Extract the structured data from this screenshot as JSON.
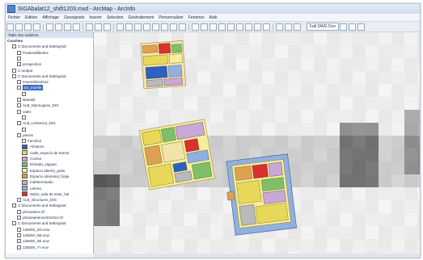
{
  "window": {
    "title": "SIGAbalat12_shift1203.mxd - ArcMap - ArcInfo"
  },
  "menu": [
    "Fichier",
    "Edition",
    "Affichage",
    "Geosignets",
    "Inserer",
    "Selection",
    "Geotraitement",
    "Personnaliser",
    "Fenetres",
    "Aide"
  ],
  "toolbar": {
    "combo_label": "Fall DWG Dov"
  },
  "toc": {
    "title": "Table des matières",
    "rows": [
      {
        "text": "Couches",
        "indent": 0,
        "bold": true
      },
      {
        "text": "C:\\Documents and Settings\\al",
        "indent": 1
      },
      {
        "text": "Postes/affaches",
        "indent": 2
      },
      {
        "text": "",
        "indent": 2
      },
      {
        "text": "prospection",
        "indent": 2
      },
      {
        "text": "C:\\output",
        "indent": 1
      },
      {
        "text": "C:\\Documents and Settings\\al",
        "indent": 1
      },
      {
        "text": "ensembles2012",
        "indent": 2
      },
      {
        "text": "Dx_moelle",
        "indent": 2,
        "selected": true
      },
      {
        "text": "",
        "indent": 3
      },
      {
        "text": "lasmaib",
        "indent": 2
      },
      {
        "text": "ALB_MursLignes_DIG",
        "indent": 2
      },
      {
        "text": "vales",
        "indent": 2
      },
      {
        "text": "",
        "indent": 3
      },
      {
        "text": "ALB_Limites12_DIG",
        "indent": 2
      },
      {
        "text": "",
        "indent": 3
      },
      {
        "text": "pieces",
        "indent": 2
      },
      {
        "text": "Function",
        "indent": 3
      },
      {
        "text": "Almacen",
        "indent": 3,
        "swatch": "#2f5fbf"
      },
      {
        "text": "Calle_espacio de transit",
        "indent": 3,
        "swatch": "#e8d85a"
      },
      {
        "text": "Cocina",
        "indent": 3,
        "swatch": "#c9a7d6"
      },
      {
        "text": "Entrada_zaguan",
        "indent": 3,
        "swatch": "#7fbf6a"
      },
      {
        "text": "Espacio abierto_patio",
        "indent": 3,
        "swatch": "#f6ee9a"
      },
      {
        "text": "Espacio artesanal_forge",
        "indent": 3,
        "swatch": "#e0a050"
      },
      {
        "text": "Indeterminado",
        "indent": 3,
        "swatch": "#b9b9b9"
      },
      {
        "text": "Letrina",
        "indent": 3,
        "swatch": "#8fb0e0"
      },
      {
        "text": "Salon_sala de estar_hal",
        "indent": 3,
        "swatch": "#d93030"
      },
      {
        "text": "ALB_Structures_DIG",
        "indent": 2
      },
      {
        "text": "C:\\Documents and Settings\\al",
        "indent": 1
      },
      {
        "text": "photo5lnec.tif",
        "indent": 2
      },
      {
        "text": "photoaerienne2010rec.tif",
        "indent": 2
      },
      {
        "text": "C:\\Documents and Settings\\al",
        "indent": 1
      },
      {
        "text": "125000_SO.ecw",
        "indent": 2
      },
      {
        "text": "125000_NE.ecw",
        "indent": 2
      },
      {
        "text": "125000_SE.ecw",
        "indent": 2
      },
      {
        "text": "125000_??.ecw",
        "indent": 2
      }
    ]
  },
  "colors": {
    "almacen": "#2f5fbf",
    "calle": "#e8d85a",
    "cocina": "#c9a7d6",
    "entrada": "#7fbf6a",
    "patio": "#f6ee9a",
    "artesanal": "#e0a050",
    "indeterminado": "#b9b9b9",
    "letrina": "#8fb0e0",
    "salon": "#d93030"
  }
}
